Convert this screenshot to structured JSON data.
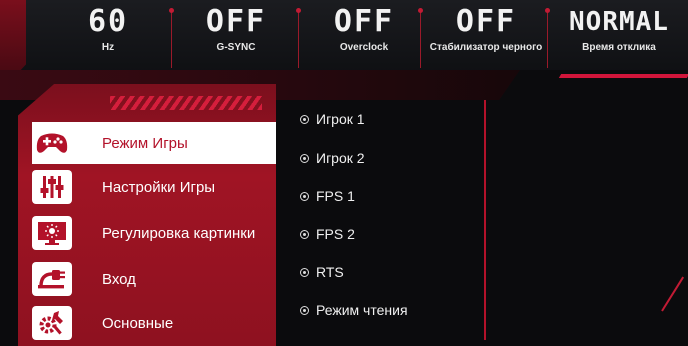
{
  "status_bar": [
    {
      "value": "60",
      "label": "Hz"
    },
    {
      "value": "OFF",
      "label": "G-SYNC"
    },
    {
      "value": "OFF",
      "label": "Overclock"
    },
    {
      "value": "OFF",
      "label": "Стабилизатор черного"
    },
    {
      "value": "NORMAL",
      "label": "Время отклика"
    }
  ],
  "menu": [
    {
      "label": "Режим Игры",
      "icon": "gamepad-icon",
      "active": true
    },
    {
      "label": "Настройки Игры",
      "icon": "sliders-icon",
      "active": false
    },
    {
      "label": "Регулировка картинки",
      "icon": "monitor-brightness-icon",
      "active": false
    },
    {
      "label": "Вход",
      "icon": "input-plug-icon",
      "active": false
    },
    {
      "label": "Основные",
      "icon": "settings-tools-icon",
      "active": false
    }
  ],
  "options": [
    "Игрок 1",
    "Игрок 2",
    "FPS 1",
    "FPS 2",
    "RTS",
    "Режим чтения"
  ],
  "colors": {
    "accent": "#b3122a",
    "panel": "#9b1322",
    "background": "#0b0b0d"
  }
}
